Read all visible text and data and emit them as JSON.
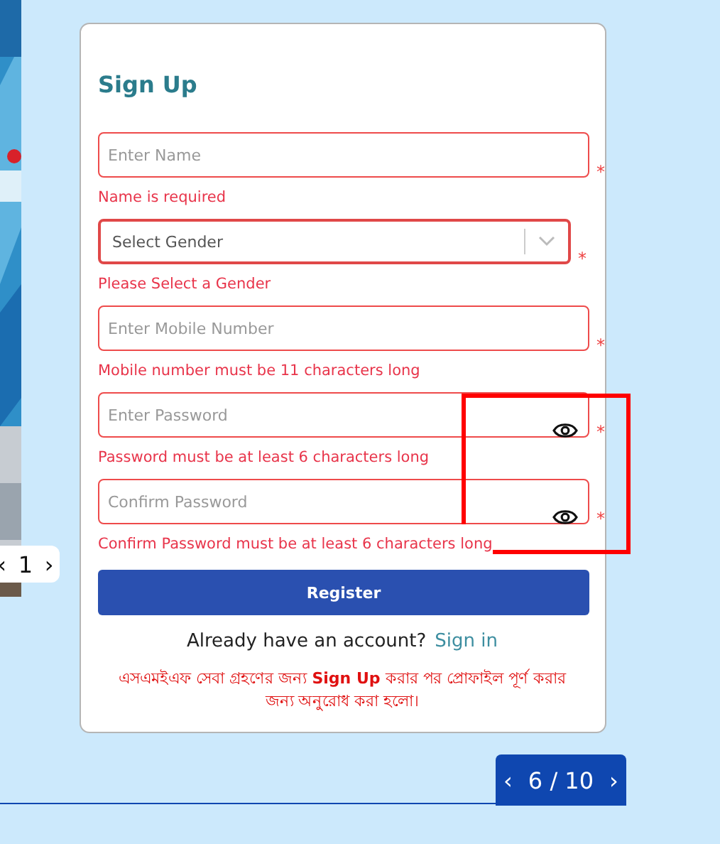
{
  "side_slide": {
    "kind": "picture",
    "pager": {
      "prev": "‹",
      "page": "1",
      "next": "›"
    }
  },
  "form": {
    "title": "Sign Up",
    "fields": [
      {
        "kind": "text",
        "placeholder": "Enter Name",
        "required": "*",
        "error": "Name is required"
      },
      {
        "kind": "select",
        "placeholder": "Select Gender",
        "required": "*",
        "error": "Please Select a Gender"
      },
      {
        "kind": "text",
        "placeholder": "Enter Mobile Number",
        "required": "*",
        "error": "Mobile number must be 11 characters long"
      },
      {
        "kind": "password",
        "placeholder": "Enter Password",
        "required": "*",
        "error": "Password must be at least 6 characters long"
      },
      {
        "kind": "password",
        "placeholder": "Confirm Password",
        "required": "*",
        "error": "Confirm Password must be at least 6 characters long"
      }
    ],
    "submit": "Register",
    "signin_prompt": "Already have an account?",
    "signin_link": "Sign in",
    "notice": "এসএমইএফ সেবা গ্রহণের জন্য **Sign Up** করার পর প্রোফাইল পূর্ণ করার জন্য অনুরোধ করা হলো।"
  },
  "annotation": {
    "highlight_shown": true
  },
  "pager": {
    "prev": "‹",
    "page": "6 / 10",
    "next": "›"
  }
}
